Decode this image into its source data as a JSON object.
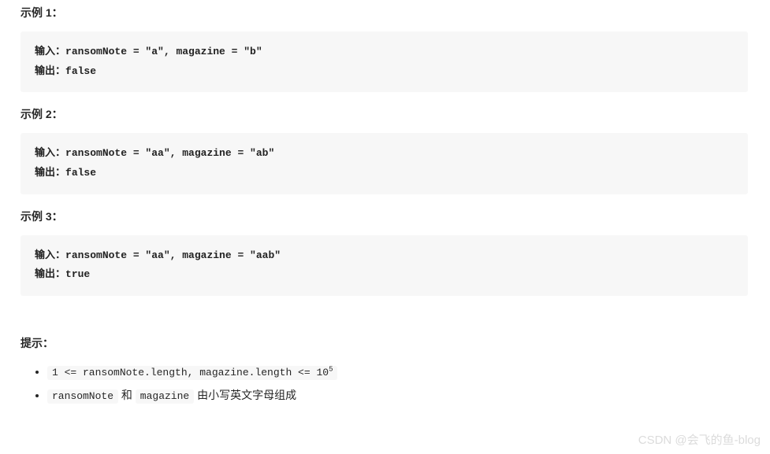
{
  "examples": [
    {
      "heading": "示例 1：",
      "input_label": "输入：",
      "output_label": "输出：",
      "input_value": "ransomNote = \"a\", magazine = \"b\"",
      "output_value": "false"
    },
    {
      "heading": "示例 2：",
      "input_label": "输入：",
      "output_label": "输出：",
      "input_value": "ransomNote = \"aa\", magazine = \"ab\"",
      "output_value": "false"
    },
    {
      "heading": "示例 3：",
      "input_label": "输入：",
      "output_label": "输出：",
      "input_value": "ransomNote = \"aa\", magazine = \"aab\"",
      "output_value": "true"
    }
  ],
  "tips": {
    "heading": "提示：",
    "item1_code": "1 <= ransomNote.length, magazine.length <= 10",
    "item1_sup": "5",
    "item2_code1": "ransomNote",
    "item2_mid": " 和 ",
    "item2_code2": "magazine",
    "item2_tail": " 由小写英文字母组成"
  },
  "watermark": "CSDN @会飞的鱼-blog"
}
